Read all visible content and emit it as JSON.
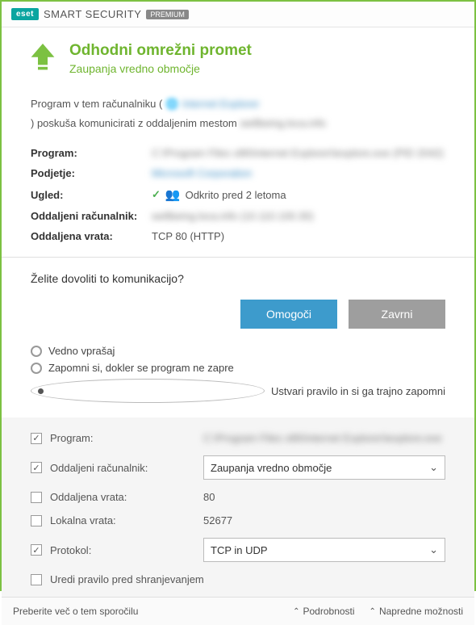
{
  "titlebar": {
    "brand": "eset",
    "product": "SMART SECURITY",
    "edition": "PREMIUM"
  },
  "header": {
    "title": "Odhodni omrežni promet",
    "subtitle": "Zaupanja vredno območje"
  },
  "desc": {
    "pre": "Program v tem računalniku (",
    "app_blur": "Internet Explorer",
    "post": ") poskuša komunicirati z oddaljenim mestom",
    "tail_blur": "wellbeing.loca.info"
  },
  "fields": {
    "program_label": "Program:",
    "program_val": "C:\\Program Files x86\\Internet Explorer\\iexplore.exe (PID 2042)",
    "company_label": "Podjetje:",
    "company_val": "Microsoft Corporation",
    "rep_label": "Ugled:",
    "rep_val": "Odkrito pred 2 letoma",
    "remote_label": "Oddaljeni računalnik:",
    "remote_val": "wellbeing.loca.info (10.110.100.30)",
    "port_label": "Oddaljena vrata:",
    "port_val": "TCP 80 (HTTP)"
  },
  "ask": "Želite dovoliti to komunikacijo?",
  "buttons": {
    "allow": "Omogoči",
    "deny": "Zavrni"
  },
  "radios": {
    "always_ask": "Vedno vprašaj",
    "remember_until_close": "Zapomni si, dokler se program ne zapre",
    "create_rule": "Ustvari pravilo in si ga trajno zapomni"
  },
  "rules": {
    "program_label": "Program:",
    "program_val": "C:\\Program Files x86\\Internet Explorer\\iexplore.exe",
    "remote_label": "Oddaljeni računalnik:",
    "remote_select": "Zaupanja vredno območje",
    "rport_label": "Oddaljena vrata:",
    "rport_val": "80",
    "lport_label": "Lokalna vrata:",
    "lport_val": "52677",
    "proto_label": "Protokol:",
    "proto_select": "TCP in UDP",
    "edit_label": "Uredi pravilo pred shranjevanjem"
  },
  "footer": {
    "more": "Preberite več o tem sporočilu",
    "details": "Podrobnosti",
    "advanced": "Napredne možnosti"
  }
}
